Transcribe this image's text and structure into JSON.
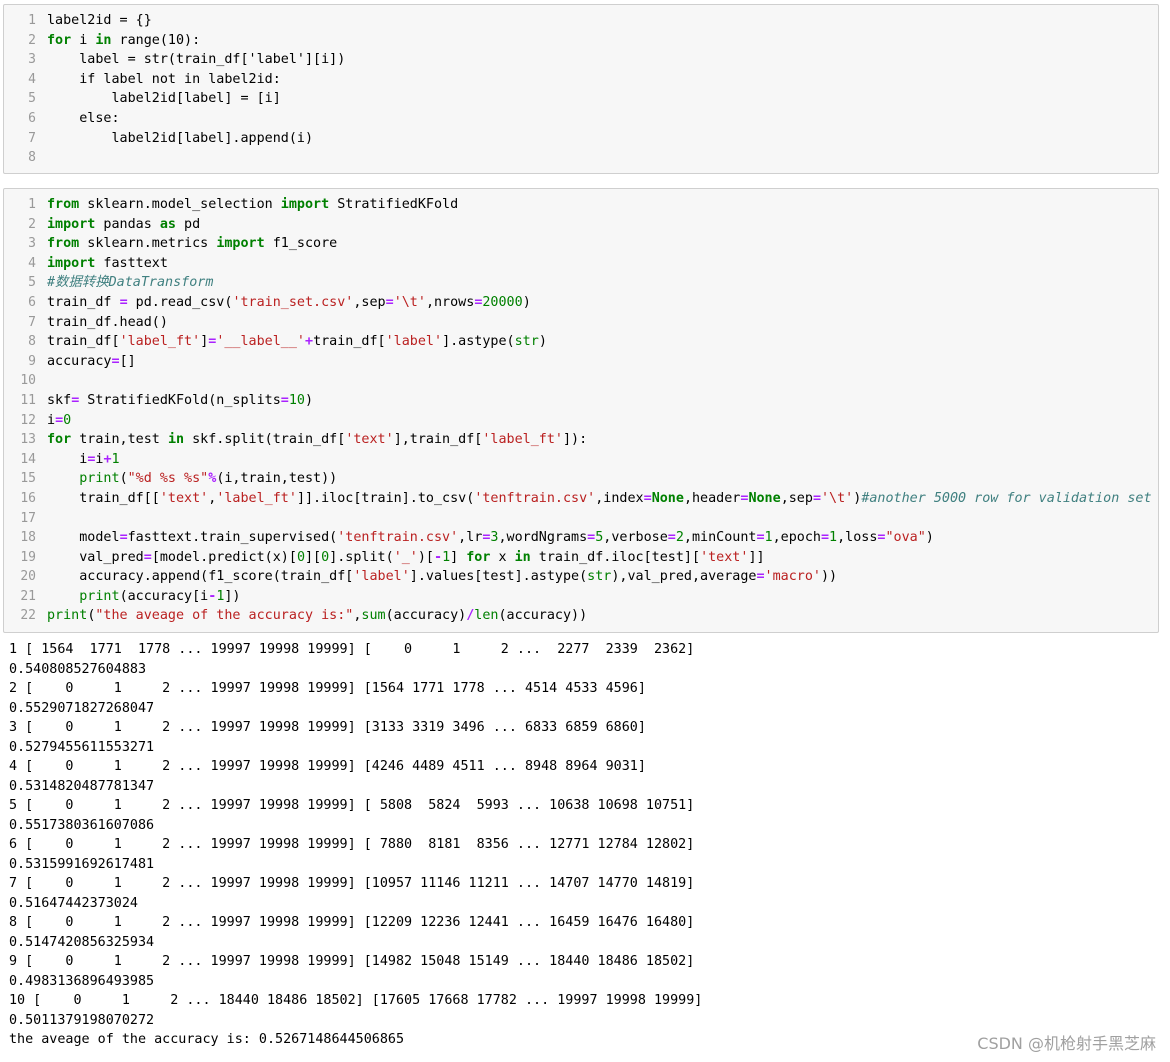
{
  "cell1": {
    "line_numbers": [
      "1",
      "2",
      "3",
      "4",
      "5",
      "6",
      "7",
      "8"
    ],
    "lines": [
      [
        {
          "t": "label2id = {}"
        }
      ],
      [
        {
          "t": "for",
          "c": "kw"
        },
        {
          "t": " i "
        },
        {
          "t": "in",
          "c": "kw"
        },
        {
          "t": " range(10):"
        }
      ],
      [
        {
          "t": "    label = str(train_df['label'][i])"
        }
      ],
      [
        {
          "t": "    if label not in label2id:"
        }
      ],
      [
        {
          "t": "        label2id[label] = [i]"
        }
      ],
      [
        {
          "t": "    else:"
        }
      ],
      [
        {
          "t": "        label2id[label].append(i)"
        }
      ],
      [
        {
          "t": ""
        }
      ]
    ]
  },
  "cell2": {
    "line_numbers": [
      "1",
      "2",
      "3",
      "4",
      "5",
      "6",
      "7",
      "8",
      "9",
      "10",
      "11",
      "12",
      "13",
      "14",
      "15",
      "16",
      "17",
      "18",
      "19",
      "20",
      "21",
      "22"
    ],
    "lines": [
      [
        {
          "t": "from",
          "c": "kw"
        },
        {
          "t": " sklearn.model_selection "
        },
        {
          "t": "import",
          "c": "kw"
        },
        {
          "t": " StratifiedKFold"
        }
      ],
      [
        {
          "t": "import",
          "c": "kw"
        },
        {
          "t": " pandas "
        },
        {
          "t": "as",
          "c": "kw"
        },
        {
          "t": " pd"
        }
      ],
      [
        {
          "t": "from",
          "c": "kw"
        },
        {
          "t": " sklearn.metrics "
        },
        {
          "t": "import",
          "c": "kw"
        },
        {
          "t": " f1_score"
        }
      ],
      [
        {
          "t": "import",
          "c": "kw"
        },
        {
          "t": " fasttext"
        }
      ],
      [
        {
          "t": "#数据转换DataTransform",
          "c": "cm"
        }
      ],
      [
        {
          "t": "train_df "
        },
        {
          "t": "=",
          "c": "op"
        },
        {
          "t": " pd.read_csv("
        },
        {
          "t": "'train_set.csv'",
          "c": "st"
        },
        {
          "t": ",sep"
        },
        {
          "t": "=",
          "c": "op"
        },
        {
          "t": "'\\t'",
          "c": "st"
        },
        {
          "t": ",nrows"
        },
        {
          "t": "=",
          "c": "op"
        },
        {
          "t": "20000",
          "c": "nu"
        },
        {
          "t": ")"
        }
      ],
      [
        {
          "t": "train_df.head()"
        }
      ],
      [
        {
          "t": "train_df["
        },
        {
          "t": "'label_ft'",
          "c": "st"
        },
        {
          "t": "]"
        },
        {
          "t": "=",
          "c": "op"
        },
        {
          "t": "'__label__'",
          "c": "st"
        },
        {
          "t": "+",
          "c": "op"
        },
        {
          "t": "train_df["
        },
        {
          "t": "'label'",
          "c": "st"
        },
        {
          "t": "].astype("
        },
        {
          "t": "str",
          "c": "bi"
        },
        {
          "t": ")"
        }
      ],
      [
        {
          "t": "accuracy"
        },
        {
          "t": "=",
          "c": "op"
        },
        {
          "t": "[]"
        }
      ],
      [
        {
          "t": ""
        }
      ],
      [
        {
          "t": "skf"
        },
        {
          "t": "=",
          "c": "op"
        },
        {
          "t": " StratifiedKFold(n_splits"
        },
        {
          "t": "=",
          "c": "op"
        },
        {
          "t": "10",
          "c": "nu"
        },
        {
          "t": ")"
        }
      ],
      [
        {
          "t": "i"
        },
        {
          "t": "=",
          "c": "op"
        },
        {
          "t": "0",
          "c": "nu"
        }
      ],
      [
        {
          "t": "for",
          "c": "kw"
        },
        {
          "t": " train,test "
        },
        {
          "t": "in",
          "c": "kw"
        },
        {
          "t": " skf.split(train_df["
        },
        {
          "t": "'text'",
          "c": "st"
        },
        {
          "t": "],train_df["
        },
        {
          "t": "'label_ft'",
          "c": "st"
        },
        {
          "t": "]):"
        }
      ],
      [
        {
          "t": "    i"
        },
        {
          "t": "=",
          "c": "op"
        },
        {
          "t": "i"
        },
        {
          "t": "+",
          "c": "op"
        },
        {
          "t": "1",
          "c": "nu"
        }
      ],
      [
        {
          "t": "    "
        },
        {
          "t": "print",
          "c": "bi"
        },
        {
          "t": "("
        },
        {
          "t": "\"%d %s %s\"",
          "c": "st"
        },
        {
          "t": "%",
          "c": "op"
        },
        {
          "t": "(i,train,test))"
        }
      ],
      [
        {
          "t": "    train_df[["
        },
        {
          "t": "'text'",
          "c": "st"
        },
        {
          "t": ","
        },
        {
          "t": "'label_ft'",
          "c": "st"
        },
        {
          "t": "]].iloc[train].to_csv("
        },
        {
          "t": "'tenftrain.csv'",
          "c": "st"
        },
        {
          "t": ",index"
        },
        {
          "t": "=",
          "c": "op"
        },
        {
          "t": "None",
          "c": "kw"
        },
        {
          "t": ",header"
        },
        {
          "t": "=",
          "c": "op"
        },
        {
          "t": "None",
          "c": "kw"
        },
        {
          "t": ",sep"
        },
        {
          "t": "=",
          "c": "op"
        },
        {
          "t": "'\\t'",
          "c": "st"
        },
        {
          "t": ")"
        },
        {
          "t": "#another 5000 row for validation set",
          "c": "cm"
        }
      ],
      [
        {
          "t": ""
        }
      ],
      [
        {
          "t": "    model"
        },
        {
          "t": "=",
          "c": "op"
        },
        {
          "t": "fasttext.train_supervised("
        },
        {
          "t": "'tenftrain.csv'",
          "c": "st"
        },
        {
          "t": ",lr"
        },
        {
          "t": "=",
          "c": "op"
        },
        {
          "t": "3",
          "c": "nu"
        },
        {
          "t": ",wordNgrams"
        },
        {
          "t": "=",
          "c": "op"
        },
        {
          "t": "5",
          "c": "nu"
        },
        {
          "t": ",verbose"
        },
        {
          "t": "=",
          "c": "op"
        },
        {
          "t": "2",
          "c": "nu"
        },
        {
          "t": ",minCount"
        },
        {
          "t": "=",
          "c": "op"
        },
        {
          "t": "1",
          "c": "nu"
        },
        {
          "t": ",epoch"
        },
        {
          "t": "=",
          "c": "op"
        },
        {
          "t": "1",
          "c": "nu"
        },
        {
          "t": ",loss"
        },
        {
          "t": "=",
          "c": "op"
        },
        {
          "t": "\"ova\"",
          "c": "st"
        },
        {
          "t": ")"
        }
      ],
      [
        {
          "t": "    val_pred"
        },
        {
          "t": "=",
          "c": "op"
        },
        {
          "t": "[model.predict(x)["
        },
        {
          "t": "0",
          "c": "nu"
        },
        {
          "t": "]["
        },
        {
          "t": "0",
          "c": "nu"
        },
        {
          "t": "].split("
        },
        {
          "t": "'_'",
          "c": "st"
        },
        {
          "t": ")["
        },
        {
          "t": "-",
          "c": "op"
        },
        {
          "t": "1",
          "c": "nu"
        },
        {
          "t": "] "
        },
        {
          "t": "for",
          "c": "kw"
        },
        {
          "t": " x "
        },
        {
          "t": "in",
          "c": "kw"
        },
        {
          "t": " train_df.iloc[test]["
        },
        {
          "t": "'text'",
          "c": "st"
        },
        {
          "t": "]]"
        }
      ],
      [
        {
          "t": "    accuracy.append(f1_score(train_df["
        },
        {
          "t": "'label'",
          "c": "st"
        },
        {
          "t": "].values[test].astype("
        },
        {
          "t": "str",
          "c": "bi"
        },
        {
          "t": "),val_pred,average"
        },
        {
          "t": "=",
          "c": "op"
        },
        {
          "t": "'macro'",
          "c": "st"
        },
        {
          "t": "))"
        }
      ],
      [
        {
          "t": "    "
        },
        {
          "t": "print",
          "c": "bi"
        },
        {
          "t": "(accuracy[i"
        },
        {
          "t": "-",
          "c": "op"
        },
        {
          "t": "1",
          "c": "nu"
        },
        {
          "t": "])"
        }
      ],
      [
        {
          "t": "print",
          "c": "bi"
        },
        {
          "t": "("
        },
        {
          "t": "\"the aveage of the accuracy is:\"",
          "c": "st"
        },
        {
          "t": ","
        },
        {
          "t": "sum",
          "c": "bi"
        },
        {
          "t": "(accuracy)"
        },
        {
          "t": "/",
          "c": "op"
        },
        {
          "t": "len",
          "c": "bi"
        },
        {
          "t": "(accuracy))"
        }
      ]
    ]
  },
  "output": [
    "1 [ 1564  1771  1778 ... 19997 19998 19999] [    0     1     2 ...  2277  2339  2362]",
    "0.540808527604883",
    "2 [    0     1     2 ... 19997 19998 19999] [1564 1771 1778 ... 4514 4533 4596]",
    "0.5529071827268047",
    "3 [    0     1     2 ... 19997 19998 19999] [3133 3319 3496 ... 6833 6859 6860]",
    "0.5279455611553271",
    "4 [    0     1     2 ... 19997 19998 19999] [4246 4489 4511 ... 8948 8964 9031]",
    "0.5314820487781347",
    "5 [    0     1     2 ... 19997 19998 19999] [ 5808  5824  5993 ... 10638 10698 10751]",
    "0.5517380361607086",
    "6 [    0     1     2 ... 19997 19998 19999] [ 7880  8181  8356 ... 12771 12784 12802]",
    "0.5315991692617481",
    "7 [    0     1     2 ... 19997 19998 19999] [10957 11146 11211 ... 14707 14770 14819]",
    "0.51647442373024",
    "8 [    0     1     2 ... 19997 19998 19999] [12209 12236 12441 ... 16459 16476 16480]",
    "0.5147420856325934",
    "9 [    0     1     2 ... 19997 19998 19999] [14982 15048 15149 ... 18440 18486 18502]",
    "0.4983136896493985",
    "10 [    0     1     2 ... 18440 18486 18502] [17605 17668 17782 ... 19997 19998 19999]",
    "0.5011379198070272",
    "the aveage of the accuracy is: 0.5267148644506865"
  ],
  "watermark": "CSDN @机枪射手黑芝麻"
}
